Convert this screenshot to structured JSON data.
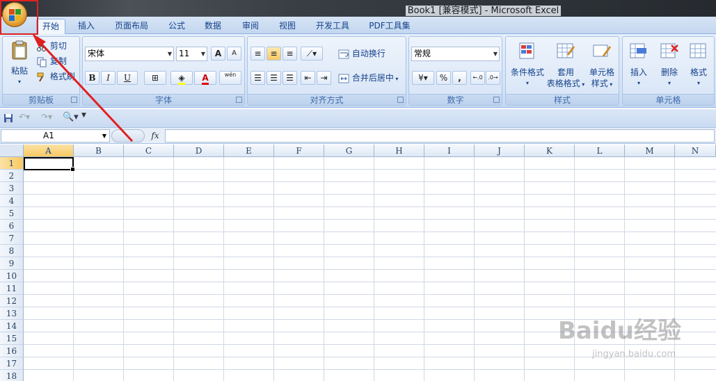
{
  "window": {
    "title": "Book1  [兼容模式] - Microsoft Excel"
  },
  "tabs": [
    "开始",
    "插入",
    "页面布局",
    "公式",
    "数据",
    "审阅",
    "视图",
    "开发工具",
    "PDF工具集"
  ],
  "clipboard": {
    "paste": "粘贴",
    "cut": "剪切",
    "copy": "复制",
    "format_painter": "格式刷",
    "label": "剪贴板"
  },
  "font": {
    "name": "宋体",
    "size": "11",
    "bold": "B",
    "italic": "I",
    "underline": "U",
    "grow": "A",
    "shrink": "A",
    "phonetic": "wén",
    "label": "字体"
  },
  "alignment": {
    "wrap": "自动换行",
    "merge": "合并后居中",
    "label": "对齐方式"
  },
  "number": {
    "format": "常规",
    "percent": "%",
    "comma": ",",
    "label": "数字"
  },
  "styles": {
    "conditional": "条件格式",
    "table_l1": "套用",
    "table_l2": "表格格式",
    "cell_l1": "单元格",
    "cell_l2": "样式",
    "label": "样式"
  },
  "cells": {
    "insert": "插入",
    "delete": "删除",
    "format": "格式",
    "label": "单元格"
  },
  "formula_bar": {
    "name_box": "A1",
    "fx": "fx",
    "value": ""
  },
  "columns": [
    "A",
    "B",
    "C",
    "D",
    "E",
    "F",
    "G",
    "H",
    "I",
    "J",
    "K",
    "L",
    "M",
    "N"
  ],
  "rows": [
    "1",
    "2",
    "3",
    "4",
    "5",
    "6",
    "7",
    "8",
    "9",
    "10",
    "11",
    "12",
    "13",
    "14",
    "15",
    "16",
    "17",
    "18"
  ],
  "active_cell": "A1",
  "watermark": {
    "brand": "Baidu经验",
    "url": "jingyan.baidu.com"
  },
  "colors": {
    "accent": "#15428b",
    "highlight": "#e02020",
    "selection": "#f8c962"
  }
}
